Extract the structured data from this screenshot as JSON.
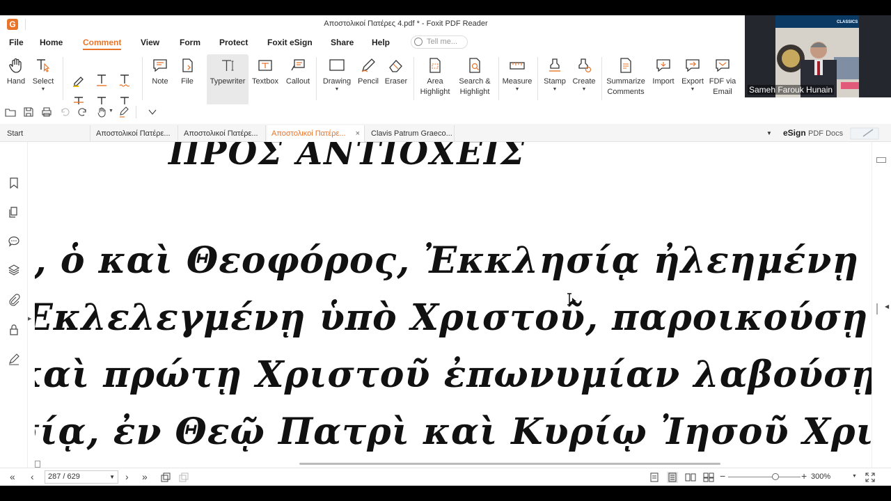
{
  "window": {
    "title": "Αποστολικοί Πατέρες 4.pdf * - Foxit PDF Reader",
    "logo_letter": "G"
  },
  "menu": {
    "items": [
      "File",
      "Home",
      "Comment",
      "View",
      "Form",
      "Protect",
      "Foxit eSign",
      "Share",
      "Help"
    ],
    "active": "Comment",
    "tell_me_placeholder": "Tell me..."
  },
  "ribbon": {
    "hand": "Hand",
    "select": "Select",
    "note": "Note",
    "file": "File",
    "typewriter": "Typewriter",
    "textbox": "Textbox",
    "callout": "Callout",
    "drawing": "Drawing",
    "pencil": "Pencil",
    "eraser": "Eraser",
    "area_highlight_1": "Area",
    "area_highlight_2": "Highlight",
    "search_highlight_1": "Search &",
    "search_highlight_2": "Highlight",
    "measure": "Measure",
    "stamp": "Stamp",
    "create": "Create",
    "summarize_1": "Summarize",
    "summarize_2": "Comments",
    "import": "Import",
    "export": "Export",
    "fdf_1": "FDF via",
    "fdf_2": "Email"
  },
  "tabs": {
    "start": "Start",
    "items": [
      "Αποστολικοί Πατέρε...",
      "Αποστολικοί Πατέρε...",
      "Αποστολικοί Πατέρε...",
      "Clavis Patrum Graeco..."
    ],
    "active_index": 2,
    "esign_bold": "eSign",
    "esign_rest": "PDF Docs"
  },
  "document": {
    "heading": "ΠΡΟΣ ΑΝΤΙΟΧΕΙΣ",
    "lines": [
      "ς, ὁ καὶ Θεοφόρος, Ἐκκλησίᾳ ἠλεημένῃ ὑπὸ",
      "Ἐκλελεγμένῃ ὑπὸ Χριστοῦ, παροικούσῃ ἐν",
      "καὶ πρώτῃ Χριστοῦ ἐπωνυμίαν λαβούσῃ, τῇ ἐν",
      "σίᾳ, ἐν Θεῷ Πατρὶ καὶ Κυρίῳ Ἰησοῦ Χριστῷ,"
    ]
  },
  "status": {
    "page": "287 / 629",
    "zoom": "300%"
  },
  "video": {
    "participant": "Sameh Farouk Hunain",
    "banner_text": "CLASSICS"
  },
  "colors": {
    "accent": "#e8742a",
    "ribbon_selected": "#e9e9e9"
  }
}
